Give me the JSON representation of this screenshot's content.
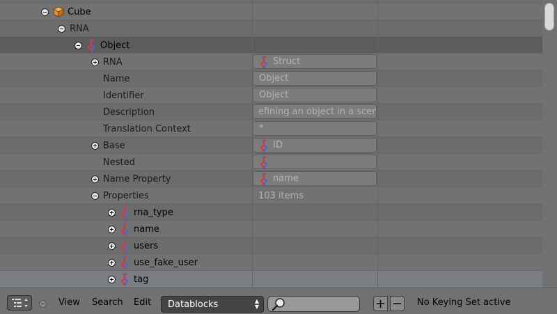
{
  "tree": {
    "rows": [
      {
        "label": "Cube",
        "icon": "cube-icon",
        "expander": "collapse"
      },
      {
        "label": "RNA",
        "icon": "",
        "expander": "collapse"
      },
      {
        "label": "Object",
        "icon": "rna-icon",
        "expander": "collapse"
      },
      {
        "label": "RNA",
        "expander": "expand",
        "value": "Struct",
        "value_icon": "rna-icon"
      },
      {
        "label": "Name",
        "value": "Object"
      },
      {
        "label": "Identifier",
        "value": "Object"
      },
      {
        "label": "Description",
        "value": "efining an object in a scene"
      },
      {
        "label": "Translation Context",
        "value": "*"
      },
      {
        "label": "Base",
        "expander": "expand",
        "value": "ID",
        "value_icon": "rna-icon"
      },
      {
        "label": "Nested",
        "value": "",
        "value_icon": "rna-icon"
      },
      {
        "label": "Name Property",
        "expander": "expand",
        "value": "name",
        "value_icon": "rna-icon"
      },
      {
        "label": "Properties",
        "expander": "collapse",
        "value": "103 items"
      },
      {
        "label": "rna_type",
        "expander": "expand",
        "icon": "rna-icon"
      },
      {
        "label": "name",
        "expander": "expand",
        "icon": "rna-icon"
      },
      {
        "label": "users",
        "expander": "expand",
        "icon": "rna-icon"
      },
      {
        "label": "use_fake_user",
        "expander": "expand",
        "icon": "rna-icon"
      },
      {
        "label": "tag",
        "expander": "expand",
        "icon": "rna-icon"
      }
    ]
  },
  "header": {
    "editor_type_icon": "outliner-icon",
    "menus": {
      "view": "View",
      "search": "Search",
      "edit": "Edit"
    },
    "display_mode": "Datablocks",
    "search_placeholder": "",
    "add_label": "+",
    "remove_label": "−",
    "keying_status": "No Keying Set active"
  },
  "colors": {
    "background": "#727272",
    "row_alt": "#6c6c6c",
    "active_row": "#5c5c5c",
    "selected_row": "#7a7e83",
    "rna_blue": "#3d6fd6",
    "rna_red": "#d23b3b",
    "cube_orange": "#e08a2e"
  }
}
